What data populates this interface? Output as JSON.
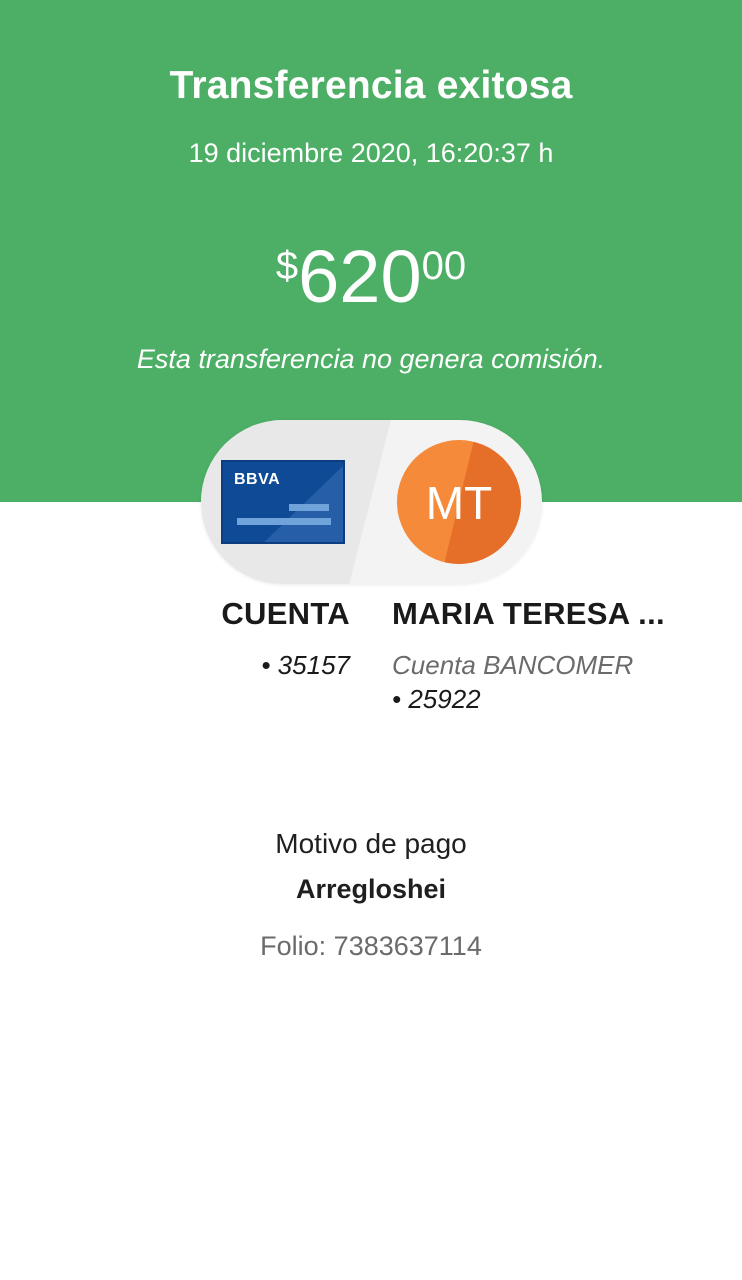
{
  "header": {
    "title": "Transferencia exitosa",
    "datetime": "19 diciembre 2020, 16:20:37 h",
    "amount": {
      "currency_symbol": "$",
      "whole": "620",
      "cents": "00"
    },
    "commission_note": "Esta transferencia no genera comisión."
  },
  "transfer": {
    "origin": {
      "card_brand": "BBVA",
      "label": "CUENTA",
      "account": "• 35157"
    },
    "destination": {
      "initials": "MT",
      "name": "MARIA TERESA ...",
      "bank": "Cuenta BANCOMER",
      "account": "• 25922"
    }
  },
  "details": {
    "motivo_label": "Motivo de pago",
    "motivo_value": "Arregloshei",
    "folio": "Folio: 7383637114"
  },
  "colors": {
    "header_bg": "#4caf65",
    "card_bg": "#0f4a96",
    "avatar_bg": "#f58b3a"
  },
  "icons": {
    "origin": "bank-card-icon",
    "destination": "avatar-initials"
  }
}
